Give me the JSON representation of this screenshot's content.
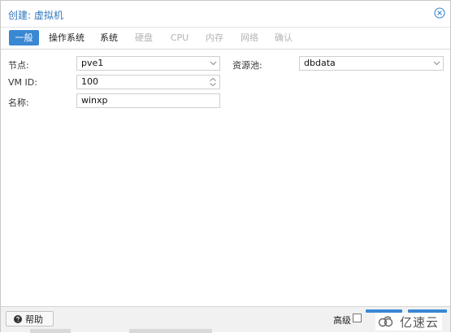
{
  "dialog": {
    "title": "创建: 虚拟机"
  },
  "tabs": [
    {
      "label": "一般",
      "state": "active"
    },
    {
      "label": "操作系统",
      "state": "enabled"
    },
    {
      "label": "系统",
      "state": "enabled"
    },
    {
      "label": "硬盘",
      "state": "disabled"
    },
    {
      "label": "CPU",
      "state": "disabled"
    },
    {
      "label": "内存",
      "state": "disabled"
    },
    {
      "label": "网络",
      "state": "disabled"
    },
    {
      "label": "确认",
      "state": "disabled"
    }
  ],
  "form": {
    "node_label": "节点:",
    "node_value": "pve1",
    "vmid_label": "VM ID:",
    "vmid_value": "100",
    "name_label": "名称:",
    "name_value": "winxp",
    "pool_label": "资源池:",
    "pool_value": "dbdata"
  },
  "footer": {
    "help_label": "帮助",
    "advanced_label": "高级",
    "advanced_checked": false
  },
  "watermark": {
    "text": "亿速云"
  },
  "colors": {
    "accent": "#3a87d3",
    "title": "#2f76bd",
    "footer_bg": "#f1f1f1"
  },
  "icons": {
    "close": "close-circle-icon",
    "help": "question-circle-icon",
    "dropdown": "chevron-down-icon",
    "spinner": "spinner-arrows-icon",
    "watermark_logo": "cloud-logo-icon"
  }
}
